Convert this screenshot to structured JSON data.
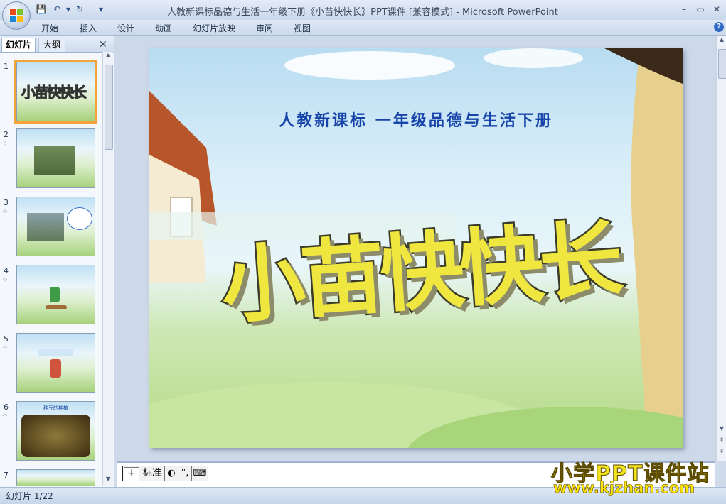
{
  "window": {
    "title": "人教新课标品德与生活一年级下册《小苗快快长》PPT课件 [兼容模式] - Microsoft PowerPoint",
    "minimize": "–",
    "restore": "▭",
    "close": "✕"
  },
  "quick_access": {
    "save": "💾",
    "undo": "↶",
    "redo": "↻",
    "more": "▾"
  },
  "ribbon": {
    "tabs": [
      "开始",
      "插入",
      "设计",
      "动画",
      "幻灯片放映",
      "审阅",
      "视图"
    ],
    "help": "?"
  },
  "left_pane": {
    "tab_slides": "幻灯片",
    "tab_outline": "大纲",
    "close": "✕",
    "slides": [
      {
        "num": "1"
      },
      {
        "num": "2",
        "icon": "☆"
      },
      {
        "num": "3",
        "icon": "☆"
      },
      {
        "num": "4",
        "icon": "☆"
      },
      {
        "num": "5",
        "icon": "☆"
      },
      {
        "num": "6",
        "icon": "☆"
      },
      {
        "num": "7",
        "icon": "☆"
      }
    ],
    "thumb6_label": "种豆的种植"
  },
  "slide": {
    "subtitle": "人教新课标 一年级品德与生活下册",
    "title": "小苗快快长"
  },
  "ime": {
    "mode": "标准"
  },
  "status": {
    "slide_counter": "幻灯片 1/22"
  },
  "watermark": {
    "line1": "小学PPT课件站",
    "line2": "www.kjzhan.com"
  },
  "colors": {
    "accent": "#f4a338",
    "title_fill": "#f0e640",
    "subtitle": "#1744a8"
  }
}
